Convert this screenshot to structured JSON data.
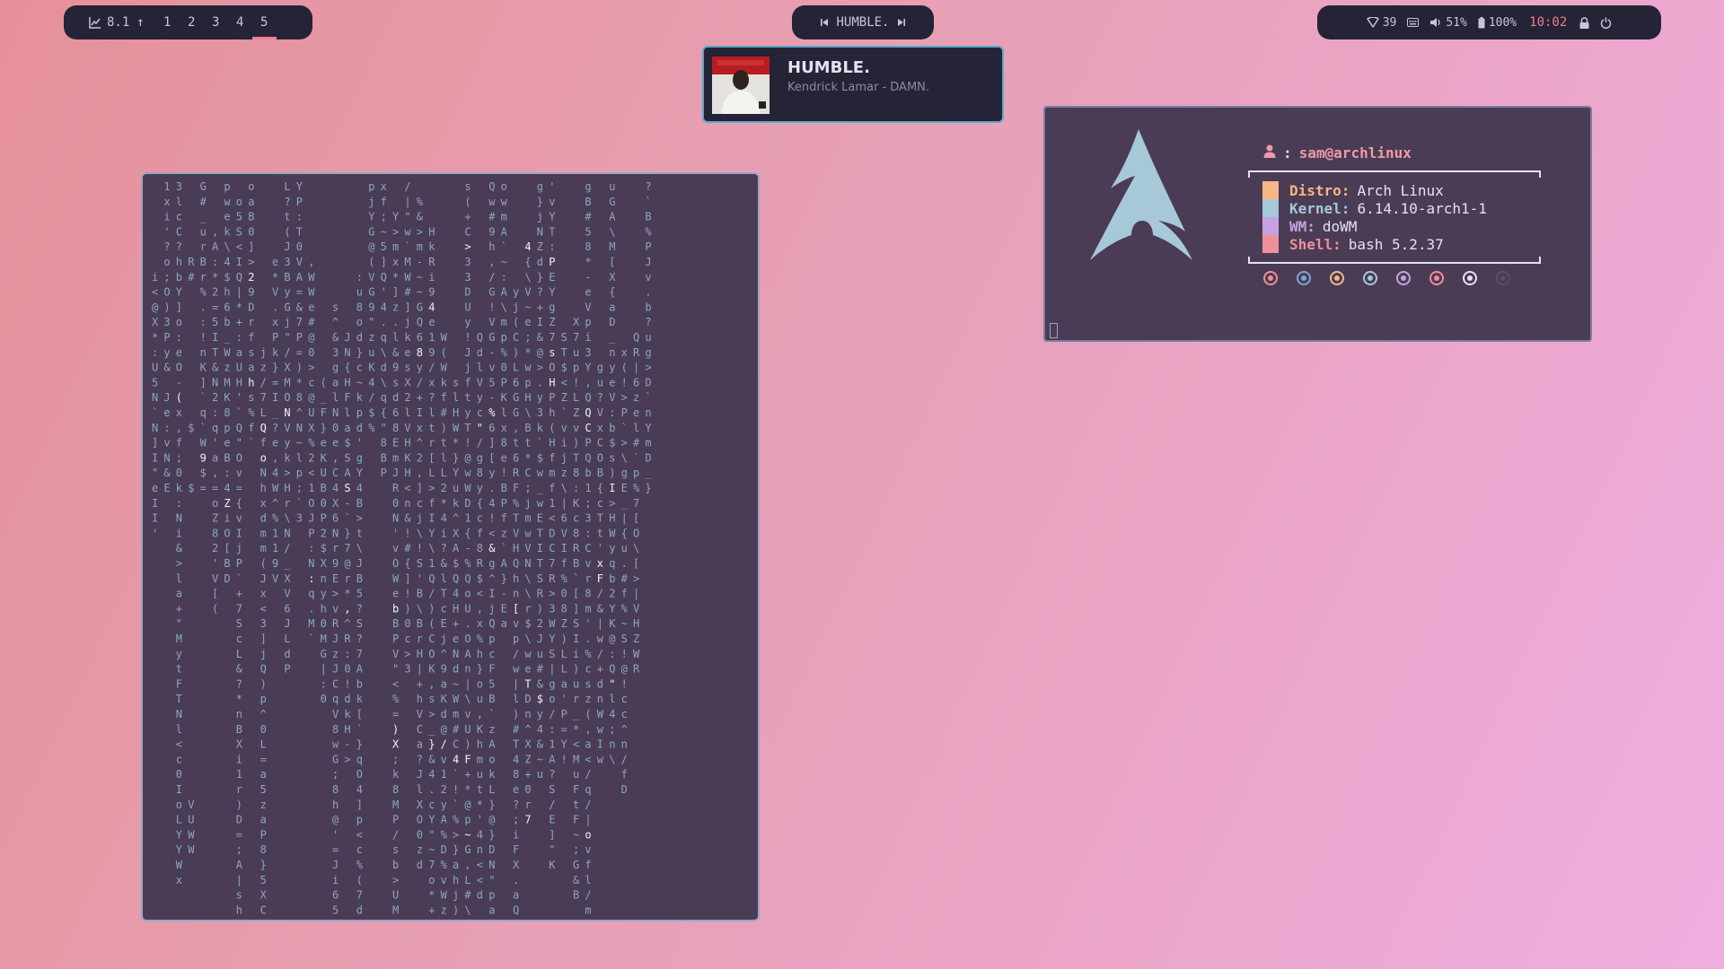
{
  "bar_left": {
    "load_icon": "chart-line-icon",
    "load_value": "8.1",
    "load_arrow": "↑",
    "workspaces": [
      "1",
      "2",
      "3",
      "4",
      "5"
    ],
    "active_workspace": "5"
  },
  "bar_center": {
    "prev_icon": "skip-back-icon",
    "track": "HUMBLE.",
    "next_icon": "skip-forward-icon"
  },
  "bar_right": {
    "wifi_icon": "wifi-icon",
    "wifi_value": "39",
    "keyboard_icon": "keyboard-icon",
    "volume_icon": "volume-icon",
    "volume_value": "51%",
    "battery_icon": "battery-icon",
    "battery_value": "100%",
    "clock": "10:02",
    "lock_icon": "lock-icon",
    "power_icon": "power-icon"
  },
  "notification": {
    "title": "HUMBLE.",
    "subtitle": "Kendrick Lamar - DAMN.",
    "cover_icon": "album-cover"
  },
  "fetch": {
    "user_icon": "user-icon",
    "separator": ":",
    "user": "sam@archlinux",
    "logo_icon": "arch-linux-logo",
    "rows": [
      {
        "label": "Distro:",
        "value": "Arch Linux",
        "color": "#f6b784"
      },
      {
        "label": "Kernel:",
        "value": "6.14.10-arch1-1",
        "color": "#a6c8d8"
      },
      {
        "label": "WM:",
        "value": "doWM",
        "color": "#c8a2e0"
      },
      {
        "label": "Shell:",
        "value": "bash 5.2.37",
        "color": "#ef8f9a"
      }
    ],
    "dots": [
      "#ef8f9a",
      "#7fa4d6",
      "#f6b784",
      "#a6c8d8",
      "#c8a2e0",
      "#ef8f9a",
      "#e4e2ee",
      "#5a4d64"
    ]
  },
  "colors": {
    "bar_bg": "#252336",
    "accent": "#ef7f8d",
    "terminal_bg": "#4a3c55",
    "rain_char": "#8ba6c4",
    "rain_bright": "#f2f2f6"
  },
  "matrix": {
    "columns": [
      [
        "",
        "",
        "",
        "",
        "",
        "",
        "i",
        "<",
        "@",
        "X",
        "*",
        ":",
        "U",
        "5",
        "N",
        "`",
        "N",
        "]",
        "I",
        "\"",
        "e",
        "I",
        "I",
        "'",
        "",
        "",
        "",
        "",
        "",
        "",
        "",
        "",
        "",
        "",
        "",
        "",
        "",
        "",
        "",
        "",
        "",
        "",
        ""
      ],
      [
        "1",
        "x",
        "i",
        "'",
        "?",
        "o",
        ";",
        "O",
        ")",
        "3",
        "P",
        "y",
        "&",
        "",
        "J",
        "e",
        ":",
        "v",
        "N",
        "&",
        "E",
        "",
        "",
        "",
        "",
        "",
        "",
        "",
        "",
        "",
        "",
        "",
        "",
        "",
        "",
        "",
        "",
        "",
        "",
        "",
        ""
      ],
      [
        "3",
        "l",
        "c",
        "C",
        "?",
        "h",
        "b",
        "Y",
        "]",
        "o",
        ":",
        "e",
        "O",
        "-",
        "(",
        "x",
        ",",
        "f",
        ";",
        "0",
        "k",
        ":",
        "N",
        "i",
        "&",
        ">",
        "l",
        "a",
        "+",
        "\"",
        "M",
        "y",
        "t",
        "F",
        "T",
        "N",
        "l",
        "<",
        "c",
        "0",
        "I",
        "o",
        "L",
        "Y",
        "Y",
        "W",
        "x"
      ],
      [
        "",
        "",
        "",
        "",
        "",
        "R",
        "#",
        "",
        "",
        "",
        "",
        "",
        "",
        "",
        "",
        "",
        "$",
        "",
        "",
        "",
        "$",
        "",
        "",
        "",
        "",
        "",
        "",
        "",
        "",
        "",
        "",
        "",
        "",
        "",
        "",
        "",
        "",
        "",
        "",
        "",
        "",
        "V",
        "U",
        "W",
        "W"
      ]
    ],
    "seed": "humble",
    "column_count": 42,
    "row_count": 49
  }
}
